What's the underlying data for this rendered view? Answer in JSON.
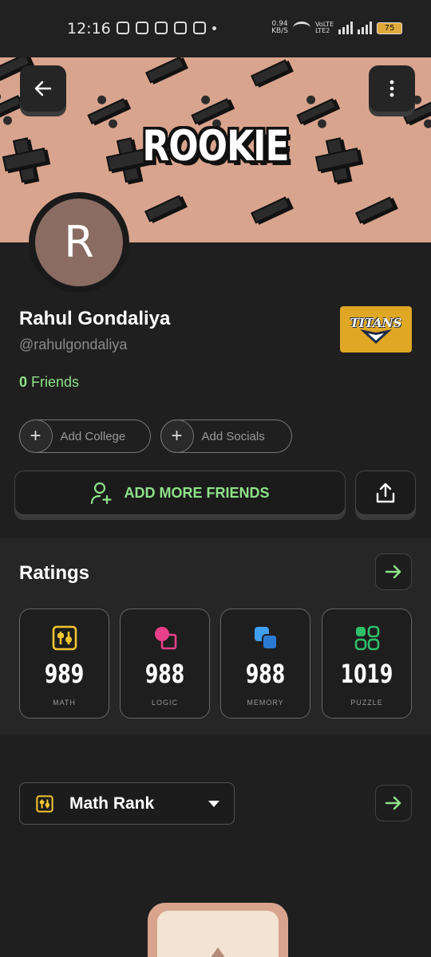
{
  "status_bar": {
    "time": "12:16",
    "net_speed_value": "0.94",
    "net_speed_unit": "KB/S",
    "volte_top": "VoLTE",
    "volte_bottom": "LTE2",
    "battery": "75"
  },
  "banner": {
    "title": "ROOKIE",
    "background_color": "#d9a48e"
  },
  "header": {
    "back_icon": "arrow-left-icon",
    "more_icon": "more-vertical-icon"
  },
  "profile": {
    "avatar_letter": "R",
    "avatar_color": "#8a6c62",
    "name": "Rahul Gondaliya",
    "handle": "@rahulgondaliya",
    "friends_count": "0",
    "friends_label": "Friends",
    "team_badge_text": "TITANS",
    "team_badge_color": "#dfa724"
  },
  "actions": {
    "add_college": "Add College",
    "add_socials": "Add Socials",
    "add_more_friends": "ADD MORE FRIENDS",
    "share_icon": "share-icon"
  },
  "ratings": {
    "title": "Ratings",
    "accent_color": "#8fe28a",
    "items": [
      {
        "value": "989",
        "label": "MATH",
        "icon": "math-icon",
        "color": "#f4c430"
      },
      {
        "value": "988",
        "label": "LOGIC",
        "icon": "logic-icon",
        "color": "#e8408a"
      },
      {
        "value": "988",
        "label": "MEMORY",
        "icon": "memory-icon",
        "color": "#3e9ef0"
      },
      {
        "value": "1019",
        "label": "PUZZLE",
        "icon": "puzzle-icon",
        "color": "#2fbf6a"
      }
    ]
  },
  "rank": {
    "selected": "Math Rank"
  }
}
